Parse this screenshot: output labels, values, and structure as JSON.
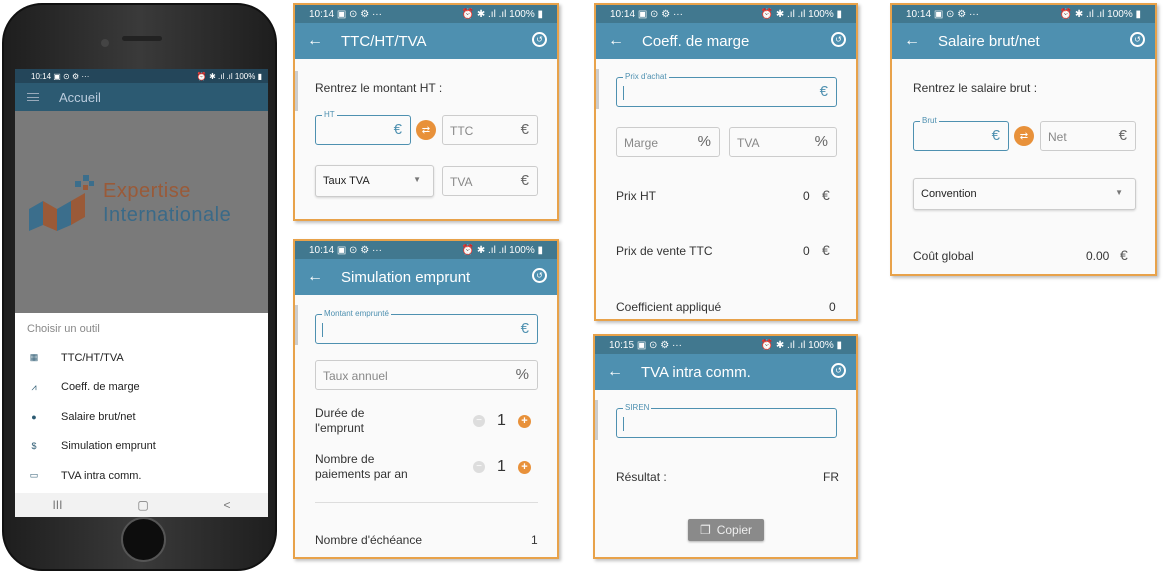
{
  "phone": {
    "status_time": "10:14",
    "status_icons": "▣ ⊙ ⚙ ···",
    "status_right": "⏰ ✱ .ıl .ıl 100% ▮",
    "appbar_title": "Accueil",
    "logo_line1": "Expertise",
    "logo_line2": "Internationale",
    "sheet_title": "Choisir un outil",
    "items": [
      {
        "label": "TTC/HT/TVA",
        "icon": "cash-register-icon"
      },
      {
        "label": "Coeff. de marge",
        "icon": "chart-line-icon"
      },
      {
        "label": "Salaire brut/net",
        "icon": "piggy-bank-icon"
      },
      {
        "label": "Simulation emprunt",
        "icon": "hand-coin-icon"
      },
      {
        "label": "TVA intra comm.",
        "icon": "credit-card-icon"
      }
    ],
    "nav": [
      "III",
      "▢",
      "<"
    ]
  },
  "ttc": {
    "status_time": "10:14",
    "status_icons": "▣ ⊙ ⚙ ···",
    "status_right": "⏰ ✱ .ıl .ıl 100% ▮",
    "title": "TTC/HT/TVA",
    "prompt": "Rentrez le montant HT :",
    "ht_label": "HT",
    "ttc_placeholder": "TTC",
    "taux_select": "Taux TVA",
    "tva_placeholder": "TVA",
    "currency": "€"
  },
  "emprunt": {
    "status_time": "10:14",
    "status_icons": "▣ ⊙ ⚙ ···",
    "status_right": "⏰ ✱ .ıl .ıl 100% ▮",
    "title": "Simulation emprunt",
    "montant_label": "Montant emprunté",
    "taux_placeholder": "Taux annuel",
    "duree_label_1": "Durée de",
    "duree_label_2": "l'emprunt",
    "duree_value": "1",
    "paiements_label_1": "Nombre de",
    "paiements_label_2": "paiements par an",
    "paiements_value": "1",
    "echeance_label": "Nombre d'échéance",
    "echeance_value": "1",
    "currency": "€",
    "percent": "%"
  },
  "marge": {
    "status_time": "10:14",
    "status_icons": "▣ ⊙ ⚙ ···",
    "status_right": "⏰ ✱ .ıl .ıl 100% ▮",
    "title": "Coeff. de marge",
    "prix_achat_label": "Prix d'achat",
    "marge_placeholder": "Marge",
    "tva_placeholder": "TVA",
    "prix_ht_label": "Prix HT",
    "prix_ht_value": "0",
    "prix_vente_label": "Prix de vente TTC",
    "prix_vente_value": "0",
    "coeff_label": "Coefficient appliqué",
    "coeff_value": "0",
    "currency": "€",
    "percent": "%"
  },
  "intra": {
    "status_time": "10:15",
    "status_icons": "▣ ⊙ ⚙ ···",
    "status_right": "⏰ ✱ .ıl .ıl 100% ▮",
    "title": "TVA intra comm.",
    "siren_label": "SIREN",
    "resultat_label": "Résultat :",
    "resultat_value": "FR",
    "copy_label": "Copier"
  },
  "salaire": {
    "status_time": "10:14",
    "status_icons": "▣ ⊙ ⚙ ···",
    "status_right": "⏰ ✱ .ıl .ıl 100% ▮",
    "title": "Salaire brut/net",
    "prompt": "Rentrez le salaire brut :",
    "brut_label": "Brut",
    "net_placeholder": "Net",
    "convention_select": "Convention",
    "cout_label": "Coût global",
    "cout_value": "0.00",
    "currency": "€"
  },
  "colors": {
    "accent": "#4e90b0",
    "status_bar": "#41788f",
    "orange": "#e8913a",
    "panel_border": "#e8a24a"
  }
}
